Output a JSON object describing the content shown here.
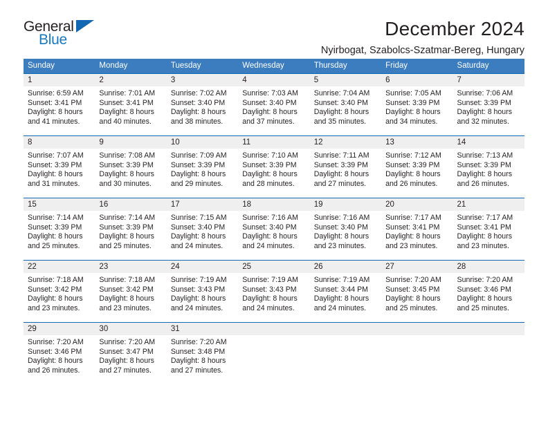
{
  "brand": {
    "name_part1": "General",
    "name_part2": "Blue"
  },
  "header": {
    "title": "December 2024",
    "subtitle": "Nyirbogat, Szabolcs-Szatmar-Bereg, Hungary"
  },
  "colors": {
    "header_bg": "#3c7dc0",
    "rule": "#1268b3",
    "daynum_bg": "#efefef",
    "brand_blue": "#1878be",
    "text": "#231f20"
  },
  "weekdays": [
    "Sunday",
    "Monday",
    "Tuesday",
    "Wednesday",
    "Thursday",
    "Friday",
    "Saturday"
  ],
  "weeks": [
    [
      {
        "day": "1",
        "sunrise": "Sunrise: 6:59 AM",
        "sunset": "Sunset: 3:41 PM",
        "daylight1": "Daylight: 8 hours",
        "daylight2": "and 41 minutes."
      },
      {
        "day": "2",
        "sunrise": "Sunrise: 7:01 AM",
        "sunset": "Sunset: 3:41 PM",
        "daylight1": "Daylight: 8 hours",
        "daylight2": "and 40 minutes."
      },
      {
        "day": "3",
        "sunrise": "Sunrise: 7:02 AM",
        "sunset": "Sunset: 3:40 PM",
        "daylight1": "Daylight: 8 hours",
        "daylight2": "and 38 minutes."
      },
      {
        "day": "4",
        "sunrise": "Sunrise: 7:03 AM",
        "sunset": "Sunset: 3:40 PM",
        "daylight1": "Daylight: 8 hours",
        "daylight2": "and 37 minutes."
      },
      {
        "day": "5",
        "sunrise": "Sunrise: 7:04 AM",
        "sunset": "Sunset: 3:40 PM",
        "daylight1": "Daylight: 8 hours",
        "daylight2": "and 35 minutes."
      },
      {
        "day": "6",
        "sunrise": "Sunrise: 7:05 AM",
        "sunset": "Sunset: 3:39 PM",
        "daylight1": "Daylight: 8 hours",
        "daylight2": "and 34 minutes."
      },
      {
        "day": "7",
        "sunrise": "Sunrise: 7:06 AM",
        "sunset": "Sunset: 3:39 PM",
        "daylight1": "Daylight: 8 hours",
        "daylight2": "and 32 minutes."
      }
    ],
    [
      {
        "day": "8",
        "sunrise": "Sunrise: 7:07 AM",
        "sunset": "Sunset: 3:39 PM",
        "daylight1": "Daylight: 8 hours",
        "daylight2": "and 31 minutes."
      },
      {
        "day": "9",
        "sunrise": "Sunrise: 7:08 AM",
        "sunset": "Sunset: 3:39 PM",
        "daylight1": "Daylight: 8 hours",
        "daylight2": "and 30 minutes."
      },
      {
        "day": "10",
        "sunrise": "Sunrise: 7:09 AM",
        "sunset": "Sunset: 3:39 PM",
        "daylight1": "Daylight: 8 hours",
        "daylight2": "and 29 minutes."
      },
      {
        "day": "11",
        "sunrise": "Sunrise: 7:10 AM",
        "sunset": "Sunset: 3:39 PM",
        "daylight1": "Daylight: 8 hours",
        "daylight2": "and 28 minutes."
      },
      {
        "day": "12",
        "sunrise": "Sunrise: 7:11 AM",
        "sunset": "Sunset: 3:39 PM",
        "daylight1": "Daylight: 8 hours",
        "daylight2": "and 27 minutes."
      },
      {
        "day": "13",
        "sunrise": "Sunrise: 7:12 AM",
        "sunset": "Sunset: 3:39 PM",
        "daylight1": "Daylight: 8 hours",
        "daylight2": "and 26 minutes."
      },
      {
        "day": "14",
        "sunrise": "Sunrise: 7:13 AM",
        "sunset": "Sunset: 3:39 PM",
        "daylight1": "Daylight: 8 hours",
        "daylight2": "and 26 minutes."
      }
    ],
    [
      {
        "day": "15",
        "sunrise": "Sunrise: 7:14 AM",
        "sunset": "Sunset: 3:39 PM",
        "daylight1": "Daylight: 8 hours",
        "daylight2": "and 25 minutes."
      },
      {
        "day": "16",
        "sunrise": "Sunrise: 7:14 AM",
        "sunset": "Sunset: 3:39 PM",
        "daylight1": "Daylight: 8 hours",
        "daylight2": "and 25 minutes."
      },
      {
        "day": "17",
        "sunrise": "Sunrise: 7:15 AM",
        "sunset": "Sunset: 3:40 PM",
        "daylight1": "Daylight: 8 hours",
        "daylight2": "and 24 minutes."
      },
      {
        "day": "18",
        "sunrise": "Sunrise: 7:16 AM",
        "sunset": "Sunset: 3:40 PM",
        "daylight1": "Daylight: 8 hours",
        "daylight2": "and 24 minutes."
      },
      {
        "day": "19",
        "sunrise": "Sunrise: 7:16 AM",
        "sunset": "Sunset: 3:40 PM",
        "daylight1": "Daylight: 8 hours",
        "daylight2": "and 23 minutes."
      },
      {
        "day": "20",
        "sunrise": "Sunrise: 7:17 AM",
        "sunset": "Sunset: 3:41 PM",
        "daylight1": "Daylight: 8 hours",
        "daylight2": "and 23 minutes."
      },
      {
        "day": "21",
        "sunrise": "Sunrise: 7:17 AM",
        "sunset": "Sunset: 3:41 PM",
        "daylight1": "Daylight: 8 hours",
        "daylight2": "and 23 minutes."
      }
    ],
    [
      {
        "day": "22",
        "sunrise": "Sunrise: 7:18 AM",
        "sunset": "Sunset: 3:42 PM",
        "daylight1": "Daylight: 8 hours",
        "daylight2": "and 23 minutes."
      },
      {
        "day": "23",
        "sunrise": "Sunrise: 7:18 AM",
        "sunset": "Sunset: 3:42 PM",
        "daylight1": "Daylight: 8 hours",
        "daylight2": "and 23 minutes."
      },
      {
        "day": "24",
        "sunrise": "Sunrise: 7:19 AM",
        "sunset": "Sunset: 3:43 PM",
        "daylight1": "Daylight: 8 hours",
        "daylight2": "and 24 minutes."
      },
      {
        "day": "25",
        "sunrise": "Sunrise: 7:19 AM",
        "sunset": "Sunset: 3:43 PM",
        "daylight1": "Daylight: 8 hours",
        "daylight2": "and 24 minutes."
      },
      {
        "day": "26",
        "sunrise": "Sunrise: 7:19 AM",
        "sunset": "Sunset: 3:44 PM",
        "daylight1": "Daylight: 8 hours",
        "daylight2": "and 24 minutes."
      },
      {
        "day": "27",
        "sunrise": "Sunrise: 7:20 AM",
        "sunset": "Sunset: 3:45 PM",
        "daylight1": "Daylight: 8 hours",
        "daylight2": "and 25 minutes."
      },
      {
        "day": "28",
        "sunrise": "Sunrise: 7:20 AM",
        "sunset": "Sunset: 3:46 PM",
        "daylight1": "Daylight: 8 hours",
        "daylight2": "and 25 minutes."
      }
    ],
    [
      {
        "day": "29",
        "sunrise": "Sunrise: 7:20 AM",
        "sunset": "Sunset: 3:46 PM",
        "daylight1": "Daylight: 8 hours",
        "daylight2": "and 26 minutes."
      },
      {
        "day": "30",
        "sunrise": "Sunrise: 7:20 AM",
        "sunset": "Sunset: 3:47 PM",
        "daylight1": "Daylight: 8 hours",
        "daylight2": "and 27 minutes."
      },
      {
        "day": "31",
        "sunrise": "Sunrise: 7:20 AM",
        "sunset": "Sunset: 3:48 PM",
        "daylight1": "Daylight: 8 hours",
        "daylight2": "and 27 minutes."
      },
      {
        "day": "",
        "sunrise": "",
        "sunset": "",
        "daylight1": "",
        "daylight2": ""
      },
      {
        "day": "",
        "sunrise": "",
        "sunset": "",
        "daylight1": "",
        "daylight2": ""
      },
      {
        "day": "",
        "sunrise": "",
        "sunset": "",
        "daylight1": "",
        "daylight2": ""
      },
      {
        "day": "",
        "sunrise": "",
        "sunset": "",
        "daylight1": "",
        "daylight2": ""
      }
    ]
  ]
}
